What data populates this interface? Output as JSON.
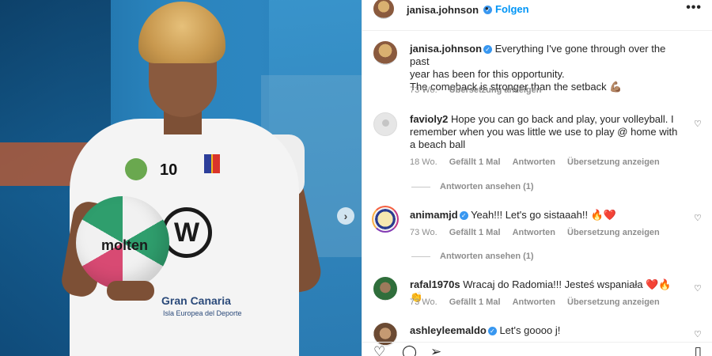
{
  "header": {
    "username": "janisa.johnson",
    "verified": true,
    "separator": "•",
    "follow_label": "Folgen",
    "more_label": "•••"
  },
  "caption": {
    "username": "janisa.johnson",
    "text_line1": "Everything I've gone through over the past",
    "text_line2": "year has been for this opportunity.",
    "text_line3": "The comeback is stronger than the setback 💪🏽",
    "time": "73 Wo.",
    "translate_label": "Übersetzung anzeigen"
  },
  "comments": [
    {
      "username": "favioly2",
      "verified": false,
      "text": "Hope you can go back and play, your volleyball. I remember when you was little we use to play @ home with a beach ball",
      "time": "18 Wo.",
      "likes": "Gefällt 1 Mal",
      "reply_label": "Antworten",
      "translate_label": "Übersetzung anzeigen",
      "view_replies": "Antworten ansehen (1)"
    },
    {
      "username": "animamjd",
      "verified": true,
      "text": "Yeah!!! Let's go sistaaah!! 🔥❤️",
      "time": "73 Wo.",
      "likes": "Gefällt 1 Mal",
      "reply_label": "Antworten",
      "translate_label": "Übersetzung anzeigen",
      "view_replies": "Antworten ansehen (1)"
    },
    {
      "username": "rafal1970s",
      "verified": false,
      "text": "Wracaj do Radomia!!! Jesteś wspaniała ❤️🔥👏",
      "time": "73 Wo.",
      "likes": "Gefällt 1 Mal",
      "reply_label": "Antworten",
      "translate_label": "Übersetzung anzeigen"
    },
    {
      "username": "ashleyleemaldo",
      "verified": true,
      "text": "Let's goooo j!"
    }
  ],
  "media": {
    "jersey_number": "10",
    "ball_brand": "molten",
    "shirt_sponsor": "Gran Canaria",
    "shirt_sponsor_sub": "Isla Europea del Deporte",
    "next_arrow": "›"
  },
  "icons": {
    "heart": "♡",
    "comment": "◯",
    "share": "➢",
    "save": "▯"
  },
  "colors": {
    "link_blue": "#0095f6",
    "verified_blue": "#3897f0",
    "meta_gray": "#8e8e8e"
  }
}
